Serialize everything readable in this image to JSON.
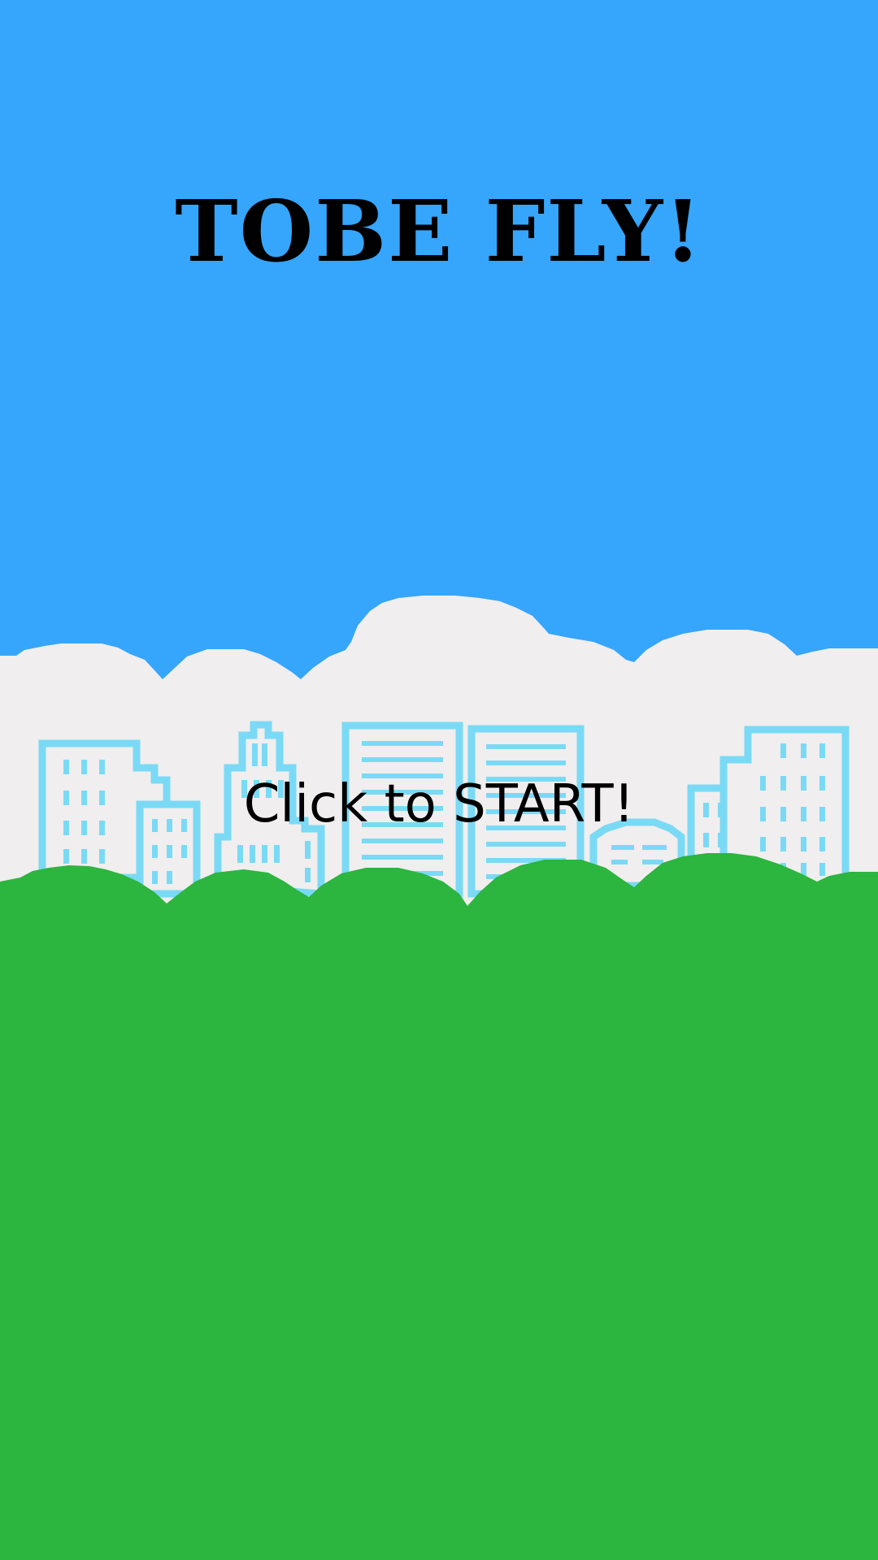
{
  "game": {
    "title": "TOBE FLY!",
    "start_prompt": "Click to START!"
  },
  "colors": {
    "sky": "#36A5FC",
    "clouds": "#F0EEEE",
    "building_outline": "#7ADAF5",
    "building_fill": "#F0EEEE",
    "grass": "#2CB53F",
    "text": "#000000"
  }
}
